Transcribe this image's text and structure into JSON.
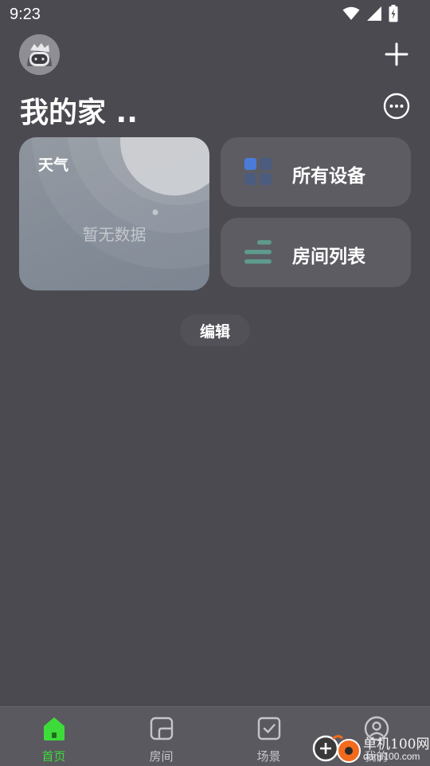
{
  "status_bar": {
    "time": "9:23"
  },
  "header": {
    "title": "我的家 .."
  },
  "weather": {
    "title": "天气",
    "empty_text": "暂无数据"
  },
  "quick_cards": [
    {
      "label": "所有设备",
      "icon": "grid-icon"
    },
    {
      "label": "房间列表",
      "icon": "list-icon"
    }
  ],
  "edit": {
    "label": "编辑"
  },
  "bottom_nav": [
    {
      "label": "首页",
      "icon": "home-icon",
      "active": true
    },
    {
      "label": "房间",
      "icon": "room-icon",
      "active": false
    },
    {
      "label": "场景",
      "icon": "scene-icon",
      "active": false
    },
    {
      "label": "我的",
      "icon": "profile-icon",
      "active": false
    }
  ],
  "watermark": {
    "line1": "单机100网",
    "line2": "danji100.com"
  },
  "colors": {
    "background": "#4b4a51",
    "card": "#5d5c63",
    "accent_green": "#3ddc3a",
    "grid_blue": "#4a7bd8",
    "list_teal": "#5f9a8e"
  }
}
